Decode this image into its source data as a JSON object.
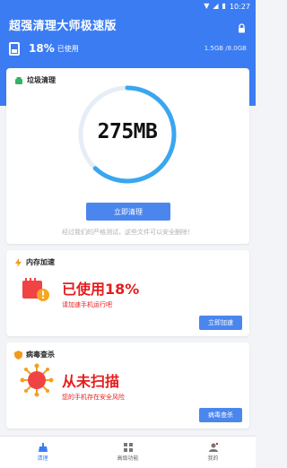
{
  "status_bar": {
    "time": "10:27",
    "icons": [
      "wifi-icon",
      "signal-icon",
      "battery-icon"
    ]
  },
  "header": {
    "title": "超强清理大师极速版",
    "storage_percent": "18%",
    "storage_used_label": "已使用",
    "storage_capacity": "1.5GB /8.0GB"
  },
  "junk": {
    "title": "垃圾清理",
    "amount": "275MB",
    "ring_progress": 0.62,
    "button": "立即清理",
    "note": "经过我们的严格测试，这些文件可以安全删除！"
  },
  "memory": {
    "title": "内存加速",
    "headline": "已使用18%",
    "subtitle": "请加速手机运行吧",
    "button": "立即加速"
  },
  "virus": {
    "title": "病毒查杀",
    "headline": "从未扫描",
    "subtitle": "您的手机存在安全风险",
    "button": "病毒查杀"
  },
  "tabs": [
    {
      "label": "清理",
      "icon": "broom-icon",
      "active": true
    },
    {
      "label": "高级功能",
      "icon": "grid-icon",
      "active": false
    },
    {
      "label": "我的",
      "icon": "person-icon",
      "active": false
    }
  ],
  "colors": {
    "primary": "#3b7cf3",
    "alert_red": "#e51d1d",
    "button_blue": "#4a86ee",
    "background": "#f2f4f7"
  }
}
